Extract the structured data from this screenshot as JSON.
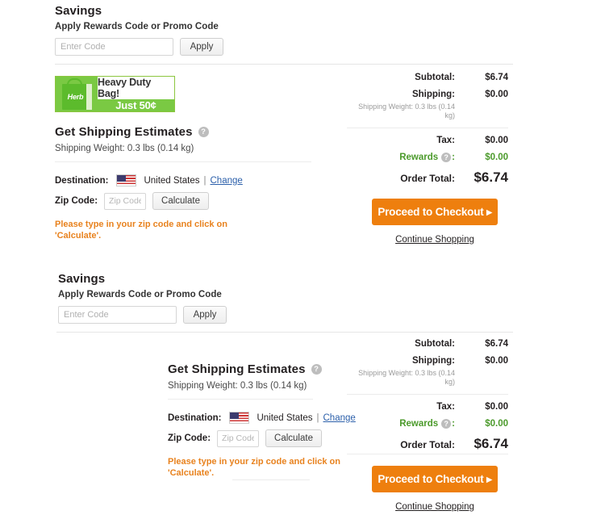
{
  "sections": [
    {
      "savings": {
        "title": "Savings",
        "subtitle": "Apply Rewards Code or Promo Code",
        "input_placeholder": "Enter Code",
        "input_value": "",
        "apply_label": "Apply"
      },
      "promo_banner": {
        "bag_text": "Herb",
        "line1": "Heavy Duty Bag!",
        "line2": "Just 50¢"
      },
      "shipping": {
        "title": "Get Shipping Estimates",
        "help_glyph": "?",
        "weight": "Shipping Weight: 0.3 lbs (0.14 kg)",
        "destination_label": "Destination:",
        "destination_country": "United States",
        "separator": "|",
        "change_label": "Change",
        "zip_label": "Zip Code:",
        "zip_placeholder": "Zip Code",
        "zip_value": "",
        "calculate_label": "Calculate",
        "warning": "Please type in your zip code and click on 'Calculate'."
      },
      "summary": {
        "subtotal_label": "Subtotal:",
        "subtotal_value": "$6.74",
        "shipping_label": "Shipping:",
        "shipping_value": "$0.00",
        "shipping_note": "Shipping Weight: 0.3 lbs (0.14 kg)",
        "tax_label": "Tax:",
        "tax_value": "$0.00",
        "rewards_label": "Rewards",
        "rewards_suffix": ":",
        "rewards_value": "$0.00",
        "total_label": "Order Total:",
        "total_value": "$6.74",
        "checkout_label": "Proceed to Checkout ▸",
        "continue_label": "Continue Shopping"
      }
    },
    {
      "savings": {
        "title": "Savings",
        "subtitle": "Apply Rewards Code or Promo Code",
        "input_placeholder": "Enter Code",
        "input_value": "",
        "apply_label": "Apply"
      },
      "shipping": {
        "title": "Get Shipping Estimates",
        "help_glyph": "?",
        "weight": "Shipping Weight: 0.3 lbs (0.14 kg)",
        "destination_label": "Destination:",
        "destination_country": "United States",
        "separator": "|",
        "change_label": "Change",
        "zip_label": "Zip Code:",
        "zip_placeholder": "Zip Code",
        "zip_value": "",
        "calculate_label": "Calculate",
        "warning": "Please type in your zip code and click on 'Calculate'."
      },
      "summary": {
        "subtotal_label": "Subtotal:",
        "subtotal_value": "$6.74",
        "shipping_label": "Shipping:",
        "shipping_value": "$0.00",
        "shipping_note": "Shipping Weight: 0.3 lbs (0.14 kg)",
        "tax_label": "Tax:",
        "tax_value": "$0.00",
        "rewards_label": "Rewards",
        "rewards_suffix": ":",
        "rewards_value": "$0.00",
        "total_label": "Order Total:",
        "total_value": "$6.74",
        "checkout_label": "Proceed to Checkout ▸",
        "continue_label": "Continue Shopping"
      }
    }
  ],
  "colors": {
    "accent_orange": "#ee7f0e",
    "rewards_green": "#4b9a2b",
    "link_blue": "#2b5faa",
    "banner_green": "#7ac943"
  }
}
